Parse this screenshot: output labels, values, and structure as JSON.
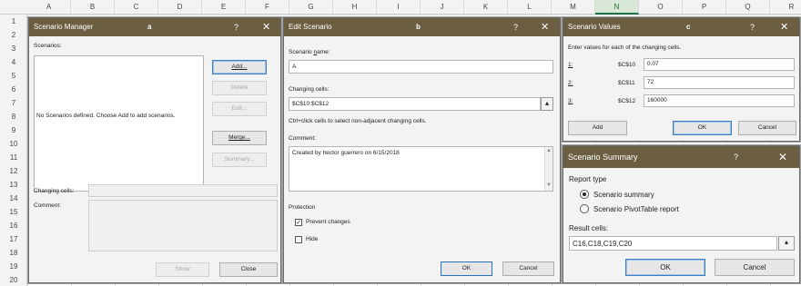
{
  "spreadsheet": {
    "columns": [
      "A",
      "B",
      "C",
      "D",
      "E",
      "F",
      "G",
      "H",
      "I",
      "J",
      "K",
      "L",
      "M",
      "N",
      "O",
      "P",
      "Q",
      "R"
    ],
    "selected_column": "N",
    "rows": [
      "1",
      "2",
      "3",
      "4",
      "5",
      "6",
      "7",
      "8",
      "9",
      "10",
      "11",
      "12",
      "13",
      "14",
      "15",
      "16",
      "17",
      "18",
      "19",
      "20"
    ]
  },
  "scenario_manager": {
    "title": "Scenario Manager",
    "panel_letter": "a",
    "help": "?",
    "close": "✕",
    "scenarios_label": "Scenarios:",
    "empty_message": "No Scenarios defined. Choose Add to add scenarios.",
    "buttons": {
      "add": "Add...",
      "delete": "Delete",
      "edit": "Edit...",
      "merge": "Merge...",
      "summary": "Summary..."
    },
    "changing_cells_label": "Changing cells:",
    "comment_label": "Comment:",
    "show": "Show",
    "close_button": "Close"
  },
  "edit_scenario": {
    "title": "Edit Scenario",
    "panel_letter": "b",
    "help": "?",
    "close": "✕",
    "name_label": "Scenario name:",
    "name_value": "A",
    "changing_cells_label": "Changing cells:",
    "changing_cells_value": "$C$10:$C$12",
    "hint": "Ctrl+click cells to select non-adjacent changing cells.",
    "comment_label": "Comment:",
    "comment_value": "Created by hector guerrero on 6/15/2018",
    "protection_label": "Protection",
    "prevent_changes": "Prevent changes",
    "prevent_changes_checked": true,
    "hide": "Hide",
    "hide_checked": false,
    "ok": "OK",
    "cancel": "Cancel"
  },
  "scenario_values": {
    "title": "Scenario Values",
    "panel_letter": "c",
    "help": "?",
    "close": "✕",
    "instruction": "Enter values for each of the changing cells.",
    "rows": [
      {
        "index": "1:",
        "cell": "$C$10",
        "value": "0.07"
      },
      {
        "index": "2:",
        "cell": "$C$11",
        "value": "72"
      },
      {
        "index": "3:",
        "cell": "$C$12",
        "value": "160000"
      }
    ],
    "add": "Add",
    "ok": "OK",
    "cancel": "Cancel"
  },
  "scenario_summary": {
    "title": "Scenario Summary",
    "help": "?",
    "close": "✕",
    "report_type_label": "Report type",
    "option_summary": "Scenario summary",
    "option_pivot": "Scenario PivotTable report",
    "selected_option": "summary",
    "result_cells_label": "Result cells:",
    "result_cells_value": "C16,C18,C19,C20",
    "ok": "OK",
    "cancel": "Cancel"
  },
  "icons": {
    "collapse_ref": "ref-collapse-icon",
    "close": "close-icon",
    "help": "help-icon"
  },
  "colors": {
    "titlebar": "#6b5e41",
    "accent": "#217346"
  }
}
